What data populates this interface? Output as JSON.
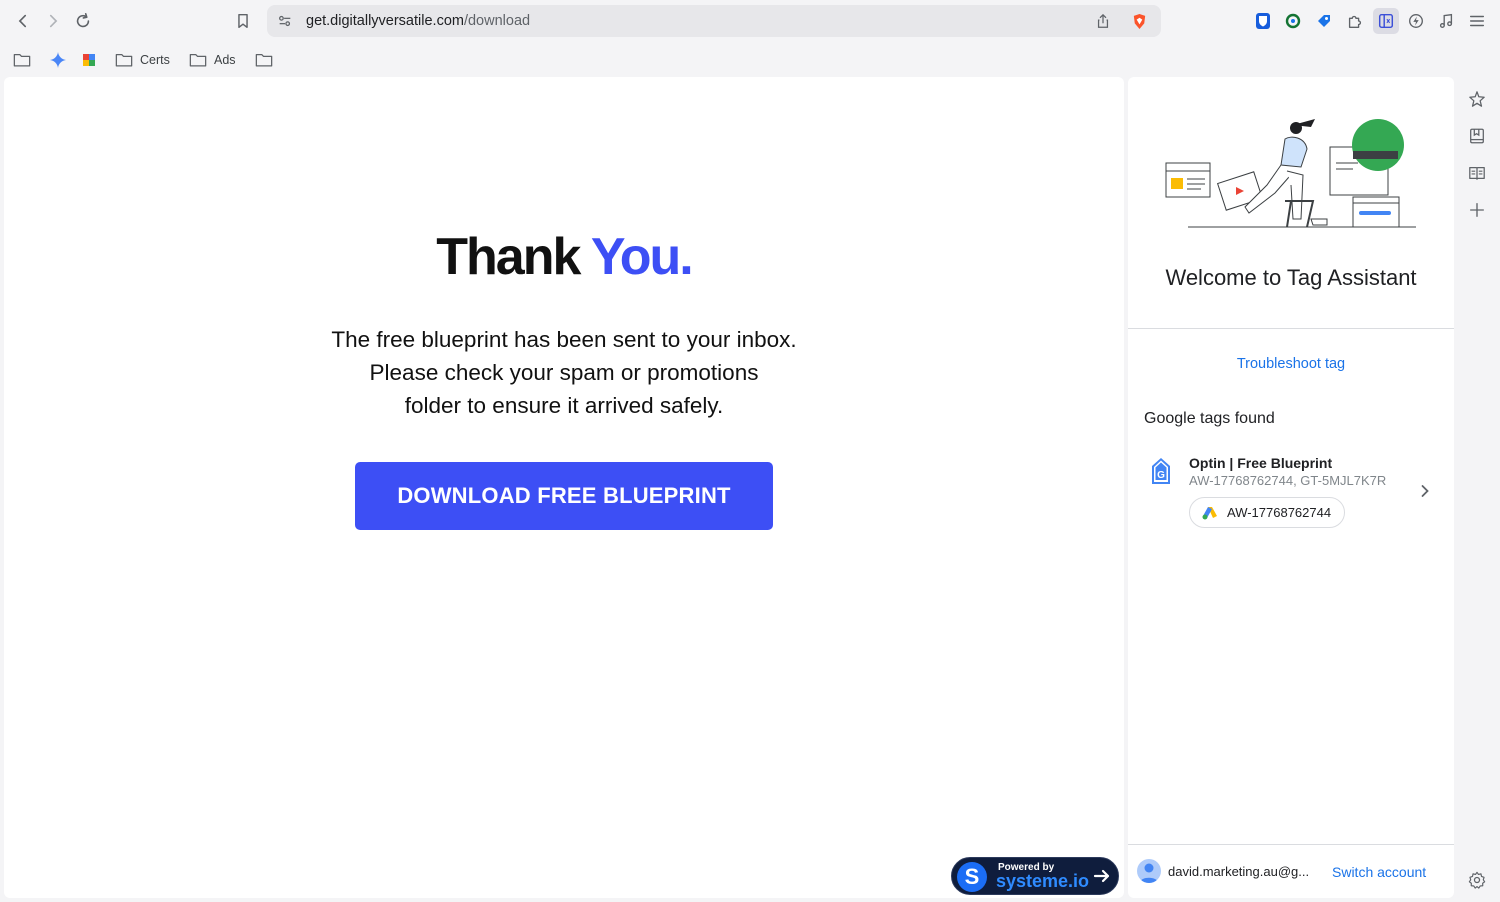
{
  "browser": {
    "url_host": "get.digitallyversatile.com",
    "url_path": "/download",
    "bookmarks": [
      {
        "label": ""
      },
      {
        "label": ""
      },
      {
        "label": ""
      },
      {
        "label": "Certs"
      },
      {
        "label": "Ads"
      },
      {
        "label": ""
      }
    ],
    "extension_icons": [
      "bitwarden-icon",
      "extension-green-icon",
      "extension-blue-tag-icon",
      "puzzle-icon",
      "sidebar-toggle-icon",
      "leo-icon",
      "music-icon",
      "menu-icon"
    ]
  },
  "page": {
    "title_main": "Thank",
    "title_accent": "You.",
    "accent_color": "#3d4ff5",
    "blurb_line1": "The free blueprint has been sent to your inbox.",
    "blurb_line2": "Please check your spam or promotions",
    "blurb_line3": "folder to ensure it arrived safely.",
    "download_label": "DOWNLOAD FREE BLUEPRINT",
    "powered_small": "Powered by",
    "powered_brand": "systeme.io",
    "powered_logo": "S"
  },
  "tag_assistant": {
    "welcome": "Welcome to Tag Assistant",
    "troubleshoot_label": "Troubleshoot tag",
    "found_heading": "Google tags found",
    "tags": [
      {
        "name": "Optin | Free Blueprint",
        "ids": "AW-17768762744, GT-5MJL7K7R",
        "chip": "AW-17768762744"
      }
    ],
    "account_email": "david.marketing.au@g...",
    "switch_label": "Switch account"
  }
}
